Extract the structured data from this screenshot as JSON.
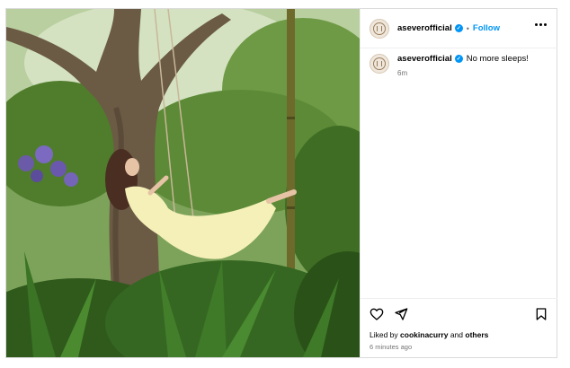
{
  "post": {
    "username": "aseverofficial",
    "follow_label": "Follow",
    "separator": "•",
    "caption_text": "No more sleeps!",
    "caption_time": "6m",
    "liked_prefix": "Liked by",
    "liked_user": "cookinacurry",
    "liked_and": "and",
    "liked_others": "others",
    "posted_ago": "6 minutes ago"
  },
  "icons": {
    "verified": "✓",
    "more": "more-options-icon",
    "like": "heart-icon",
    "share": "paper-plane-icon",
    "save": "bookmark-icon"
  },
  "colors": {
    "accent": "#0095f6",
    "muted": "#737373",
    "border": "#dbdbdb"
  }
}
